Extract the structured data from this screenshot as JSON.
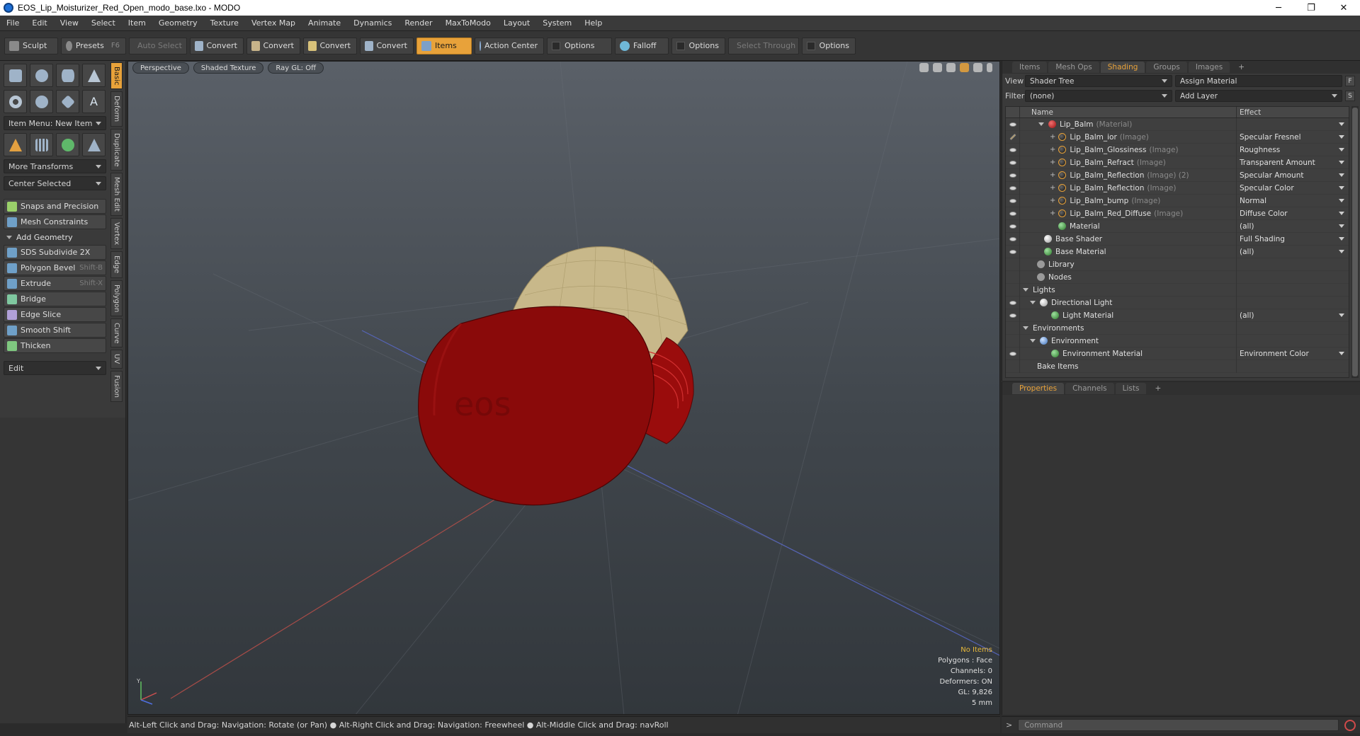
{
  "window": {
    "title": "EOS_Lip_Moisturizer_Red_Open_modo_base.lxo - MODO",
    "minimize": "─",
    "maximize": "❐",
    "close": "✕"
  },
  "menu": [
    "File",
    "Edit",
    "View",
    "Select",
    "Item",
    "Geometry",
    "Texture",
    "Vertex Map",
    "Animate",
    "Dynamics",
    "Render",
    "MaxToModo",
    "Layout",
    "System",
    "Help"
  ],
  "toolbar": {
    "sculpt": "Sculpt",
    "presets": "Presets",
    "presets_shortcut": "F6",
    "auto_select": "Auto Select",
    "convert": "Convert",
    "items": "Items",
    "action_center": "Action Center",
    "options": "Options",
    "falloff": "Falloff",
    "select_through": "Select Through"
  },
  "left_panel": {
    "item_menu": "Item Menu: New Item",
    "more_transforms": "More Transforms",
    "center_selected": "Center Selected",
    "snaps": "Snaps and Precision",
    "mesh_constraints": "Mesh Constraints",
    "add_geometry": "Add Geometry",
    "tools": [
      {
        "label": "SDS Subdivide 2X",
        "shortcut": ""
      },
      {
        "label": "Polygon Bevel",
        "shortcut": "Shift-B"
      },
      {
        "label": "Extrude",
        "shortcut": "Shift-X"
      },
      {
        "label": "Bridge",
        "shortcut": ""
      },
      {
        "label": "Edge Slice",
        "shortcut": ""
      },
      {
        "label": "Smooth Shift",
        "shortcut": ""
      },
      {
        "label": "Thicken",
        "shortcut": ""
      }
    ],
    "edit": "Edit",
    "vtabs": [
      "Basic",
      "Deform",
      "Duplicate",
      "Mesh Edit",
      "Vertex",
      "Edge",
      "Polygon",
      "Curve",
      "UV",
      "Fusion"
    ]
  },
  "viewport": {
    "view_mode": "Perspective",
    "shading": "Shaded Texture",
    "raygl": "Ray GL: Off",
    "info": {
      "selection": "No Items",
      "polygons": "Polygons : Face",
      "channels": "Channels: 0",
      "deformers": "Deformers: ON",
      "gl": "GL: 9,826",
      "scale": "5 mm"
    },
    "logo_text": "eos",
    "axis_y": "Y",
    "colors": {
      "cap": "#8a0a0a",
      "balm": "#c8b88a"
    }
  },
  "status": {
    "hint": "Alt-Left Click and Drag: Navigation: Rotate (or Pan) ● Alt-Right Click and Drag: Navigation: Freewheel ● Alt-Middle Click and Drag: navRoll"
  },
  "right_panel": {
    "tabs": [
      "Items",
      "Mesh Ops",
      "Shading",
      "Groups",
      "Images",
      "+"
    ],
    "view_label": "View",
    "view_value": "Shader Tree",
    "assign_material": "Assign Material",
    "filter_label": "Filter",
    "filter_value": "(none)",
    "add_layer": "Add Layer",
    "f_btn": "F",
    "s_btn": "S",
    "col_name": "Name",
    "col_effect": "Effect",
    "rows": [
      {
        "indent": 26,
        "exp": "tri",
        "dot": "mat",
        "name": "Lip_Balm",
        "kind": "(Material)",
        "effect": "",
        "eye": "eye"
      },
      {
        "indent": 42,
        "exp": "plus",
        "dot": "img",
        "name": "Lip_Balm_ior",
        "kind": "(Image)",
        "effect": "Specular Fresnel",
        "eye": "brush"
      },
      {
        "indent": 42,
        "exp": "plus",
        "dot": "img",
        "name": "Lip_Balm_Glossiness",
        "kind": "(Image)",
        "effect": "Roughness",
        "eye": "eye"
      },
      {
        "indent": 42,
        "exp": "plus",
        "dot": "img",
        "name": "Lip_Balm_Refract",
        "kind": "(Image)",
        "effect": "Transparent Amount",
        "eye": "eye"
      },
      {
        "indent": 42,
        "exp": "plus",
        "dot": "img",
        "name": "Lip_Balm_Reflection",
        "kind": "(Image) (2)",
        "effect": "Specular Amount",
        "eye": "eye"
      },
      {
        "indent": 42,
        "exp": "plus",
        "dot": "img",
        "name": "Lip_Balm_Reflection",
        "kind": "(Image)",
        "effect": "Specular Color",
        "eye": "eye"
      },
      {
        "indent": 42,
        "exp": "plus",
        "dot": "img",
        "name": "Lip_Balm_bump",
        "kind": "(Image)",
        "effect": "Normal",
        "eye": "eye"
      },
      {
        "indent": 42,
        "exp": "plus",
        "dot": "img",
        "name": "Lip_Balm_Red_Diffuse",
        "kind": "(Image)",
        "effect": "Diffuse Color",
        "eye": "eye"
      },
      {
        "indent": 54,
        "exp": "",
        "dot": "grn",
        "name": "Material",
        "kind": "",
        "effect": "(all)",
        "eye": "eye"
      },
      {
        "indent": 34,
        "exp": "",
        "dot": "wht",
        "name": "Base Shader",
        "kind": "",
        "effect": "Full Shading",
        "eye": "eye"
      },
      {
        "indent": 34,
        "exp": "",
        "dot": "grn",
        "name": "Base Material",
        "kind": "",
        "effect": "(all)",
        "eye": "eye"
      },
      {
        "indent": 24,
        "exp": "",
        "dot": "fold",
        "name": "Library",
        "kind": "",
        "effect": "",
        "eye": ""
      },
      {
        "indent": 24,
        "exp": "",
        "dot": "fold",
        "name": "Nodes",
        "kind": "",
        "effect": "",
        "eye": ""
      },
      {
        "indent": 4,
        "exp": "tri",
        "dot": "",
        "name": "Lights",
        "kind": "",
        "effect": "",
        "eye": ""
      },
      {
        "indent": 14,
        "exp": "tri",
        "dot": "lgt",
        "name": "Directional Light",
        "kind": "",
        "effect": "",
        "eye": "eye"
      },
      {
        "indent": 44,
        "exp": "",
        "dot": "grn",
        "name": "Light Material",
        "kind": "",
        "effect": "(all)",
        "eye": "eye"
      },
      {
        "indent": 4,
        "exp": "tri",
        "dot": "",
        "name": "Environments",
        "kind": "",
        "effect": "",
        "eye": ""
      },
      {
        "indent": 14,
        "exp": "tri",
        "dot": "env",
        "name": "Environment",
        "kind": "",
        "effect": "",
        "eye": ""
      },
      {
        "indent": 44,
        "exp": "",
        "dot": "grn",
        "name": "Environment Material",
        "kind": "",
        "effect": "Environment Color",
        "eye": "eye"
      },
      {
        "indent": 24,
        "exp": "",
        "dot": "",
        "name": "Bake Items",
        "kind": "",
        "effect": "",
        "eye": ""
      }
    ]
  },
  "props_panel": {
    "tabs": [
      "Properties",
      "Channels",
      "Lists",
      "+"
    ]
  },
  "command": {
    "prompt": ">",
    "placeholder": "Command"
  }
}
